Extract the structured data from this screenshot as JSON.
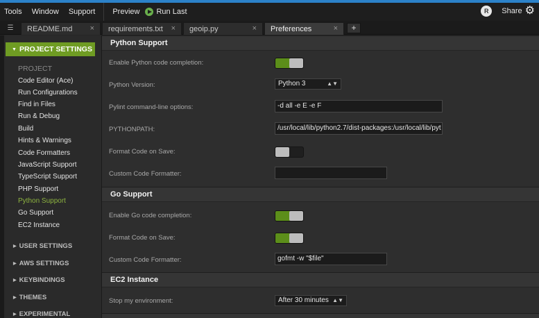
{
  "menubar": {
    "items": [
      "Tools",
      "Window",
      "Support"
    ],
    "preview_label": "Preview",
    "run_last_label": "Run Last",
    "avatar_letter": "R",
    "share_label": "Share"
  },
  "tabs": [
    {
      "label": "README.md",
      "close": "×"
    },
    {
      "label": "requirements.txt",
      "close": "×"
    },
    {
      "label": "geoip.py",
      "close": "×"
    },
    {
      "label": "Preferences",
      "close": "×"
    }
  ],
  "tab_add": "+",
  "sidebar": {
    "header": "PROJECT SETTINGS",
    "group_label": "PROJECT",
    "items": [
      "Code Editor (Ace)",
      "Run Configurations",
      "Find in Files",
      "Run & Debug",
      "Build",
      "Hints & Warnings",
      "Code Formatters",
      "JavaScript Support",
      "TypeScript Support",
      "PHP Support",
      "Python Support",
      "Go Support",
      "EC2 Instance"
    ],
    "sections": [
      "USER SETTINGS",
      "AWS SETTINGS",
      "KEYBINDINGS",
      "THEMES",
      "EXPERIMENTAL"
    ]
  },
  "python": {
    "title": "Python Support",
    "completion_label": "Enable Python code completion:",
    "completion_on": true,
    "version_label": "Python Version:",
    "version_value": "Python 3",
    "pylint_label": "Pylint command-line options:",
    "pylint_value": "-d all -e E -e F",
    "pythonpath_label": "PYTHONPATH:",
    "pythonpath_value": "/usr/local/lib/python2.7/dist-packages:/usr/local/lib/pyt",
    "format_label": "Format Code on Save:",
    "format_on": false,
    "formatter_label": "Custom Code Formatter:",
    "formatter_value": ""
  },
  "go": {
    "title": "Go Support",
    "completion_label": "Enable Go code completion:",
    "completion_on": true,
    "format_label": "Format Code on Save:",
    "format_on": true,
    "formatter_label": "Custom Code Formatter:",
    "formatter_value": "gofmt -w \"$file\""
  },
  "ec2": {
    "title": "EC2 Instance",
    "stop_label": "Stop my environment:",
    "stop_value": "After 30 minutes"
  }
}
